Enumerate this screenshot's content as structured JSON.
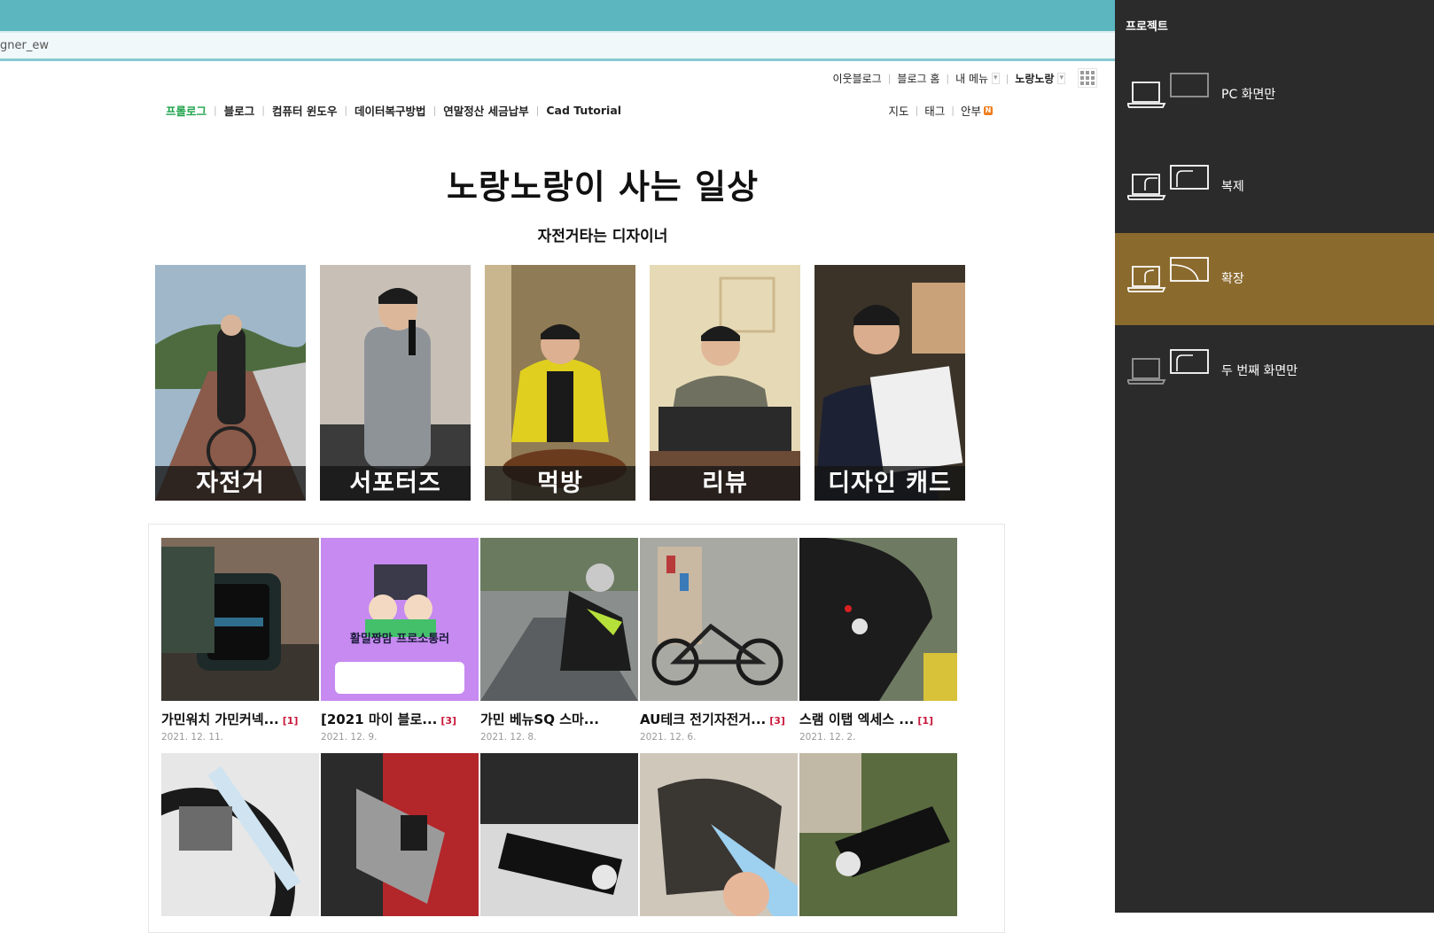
{
  "browser": {
    "address_text": "gner_ew"
  },
  "gnb": {
    "neighbors": "이웃블로그",
    "blog_home": "블로그 홈",
    "my_menu": "내 메뉴",
    "user": "노랑노랑"
  },
  "menu": {
    "items": [
      "프롤로그",
      "블로그",
      "컴퓨터 윈도우",
      "데이터복구방법",
      "연말정산 세금납부",
      "Cad Tutorial"
    ],
    "right": [
      "지도",
      "태그",
      "안부"
    ],
    "new_badge": "N"
  },
  "blog": {
    "title": "노랑노랑이 사는 일상",
    "subtitle": "자전거타는 디자이너"
  },
  "categories": [
    "자전거",
    "서포터즈",
    "먹방",
    "리뷰",
    "디자인 캐드"
  ],
  "posts": [
    {
      "title": "가민워치 가민커넥...",
      "count": "[1]",
      "date": "2021. 12. 11."
    },
    {
      "title": "[2021 마이 블로...",
      "count": "[3]",
      "date": "2021. 12. 9."
    },
    {
      "title": "가민 베뉴SQ 스마...",
      "count": "",
      "date": "2021. 12. 8."
    },
    {
      "title": "AU테크 전기자전거...",
      "count": "[3]",
      "date": "2021. 12. 6."
    },
    {
      "title": "스램 이탭 엑세스 ...",
      "count": "[1]",
      "date": "2021. 12. 2."
    }
  ],
  "project_panel": {
    "title": "프로젝트",
    "options": [
      {
        "label": "PC 화면만",
        "selected": false
      },
      {
        "label": "복제",
        "selected": false
      },
      {
        "label": "확장",
        "selected": true
      },
      {
        "label": "두 번째 화면만",
        "selected": false
      }
    ]
  },
  "colors": {
    "browser_bar": "#5bb6c0",
    "menu_active": "#1fa34a",
    "comment_count": "#c8183a",
    "panel_bg": "#2b2b2b",
    "panel_selected": "#8b6a2e"
  },
  "icons": [
    "apps-grid-icon",
    "laptop-icon",
    "monitor-icon"
  ]
}
